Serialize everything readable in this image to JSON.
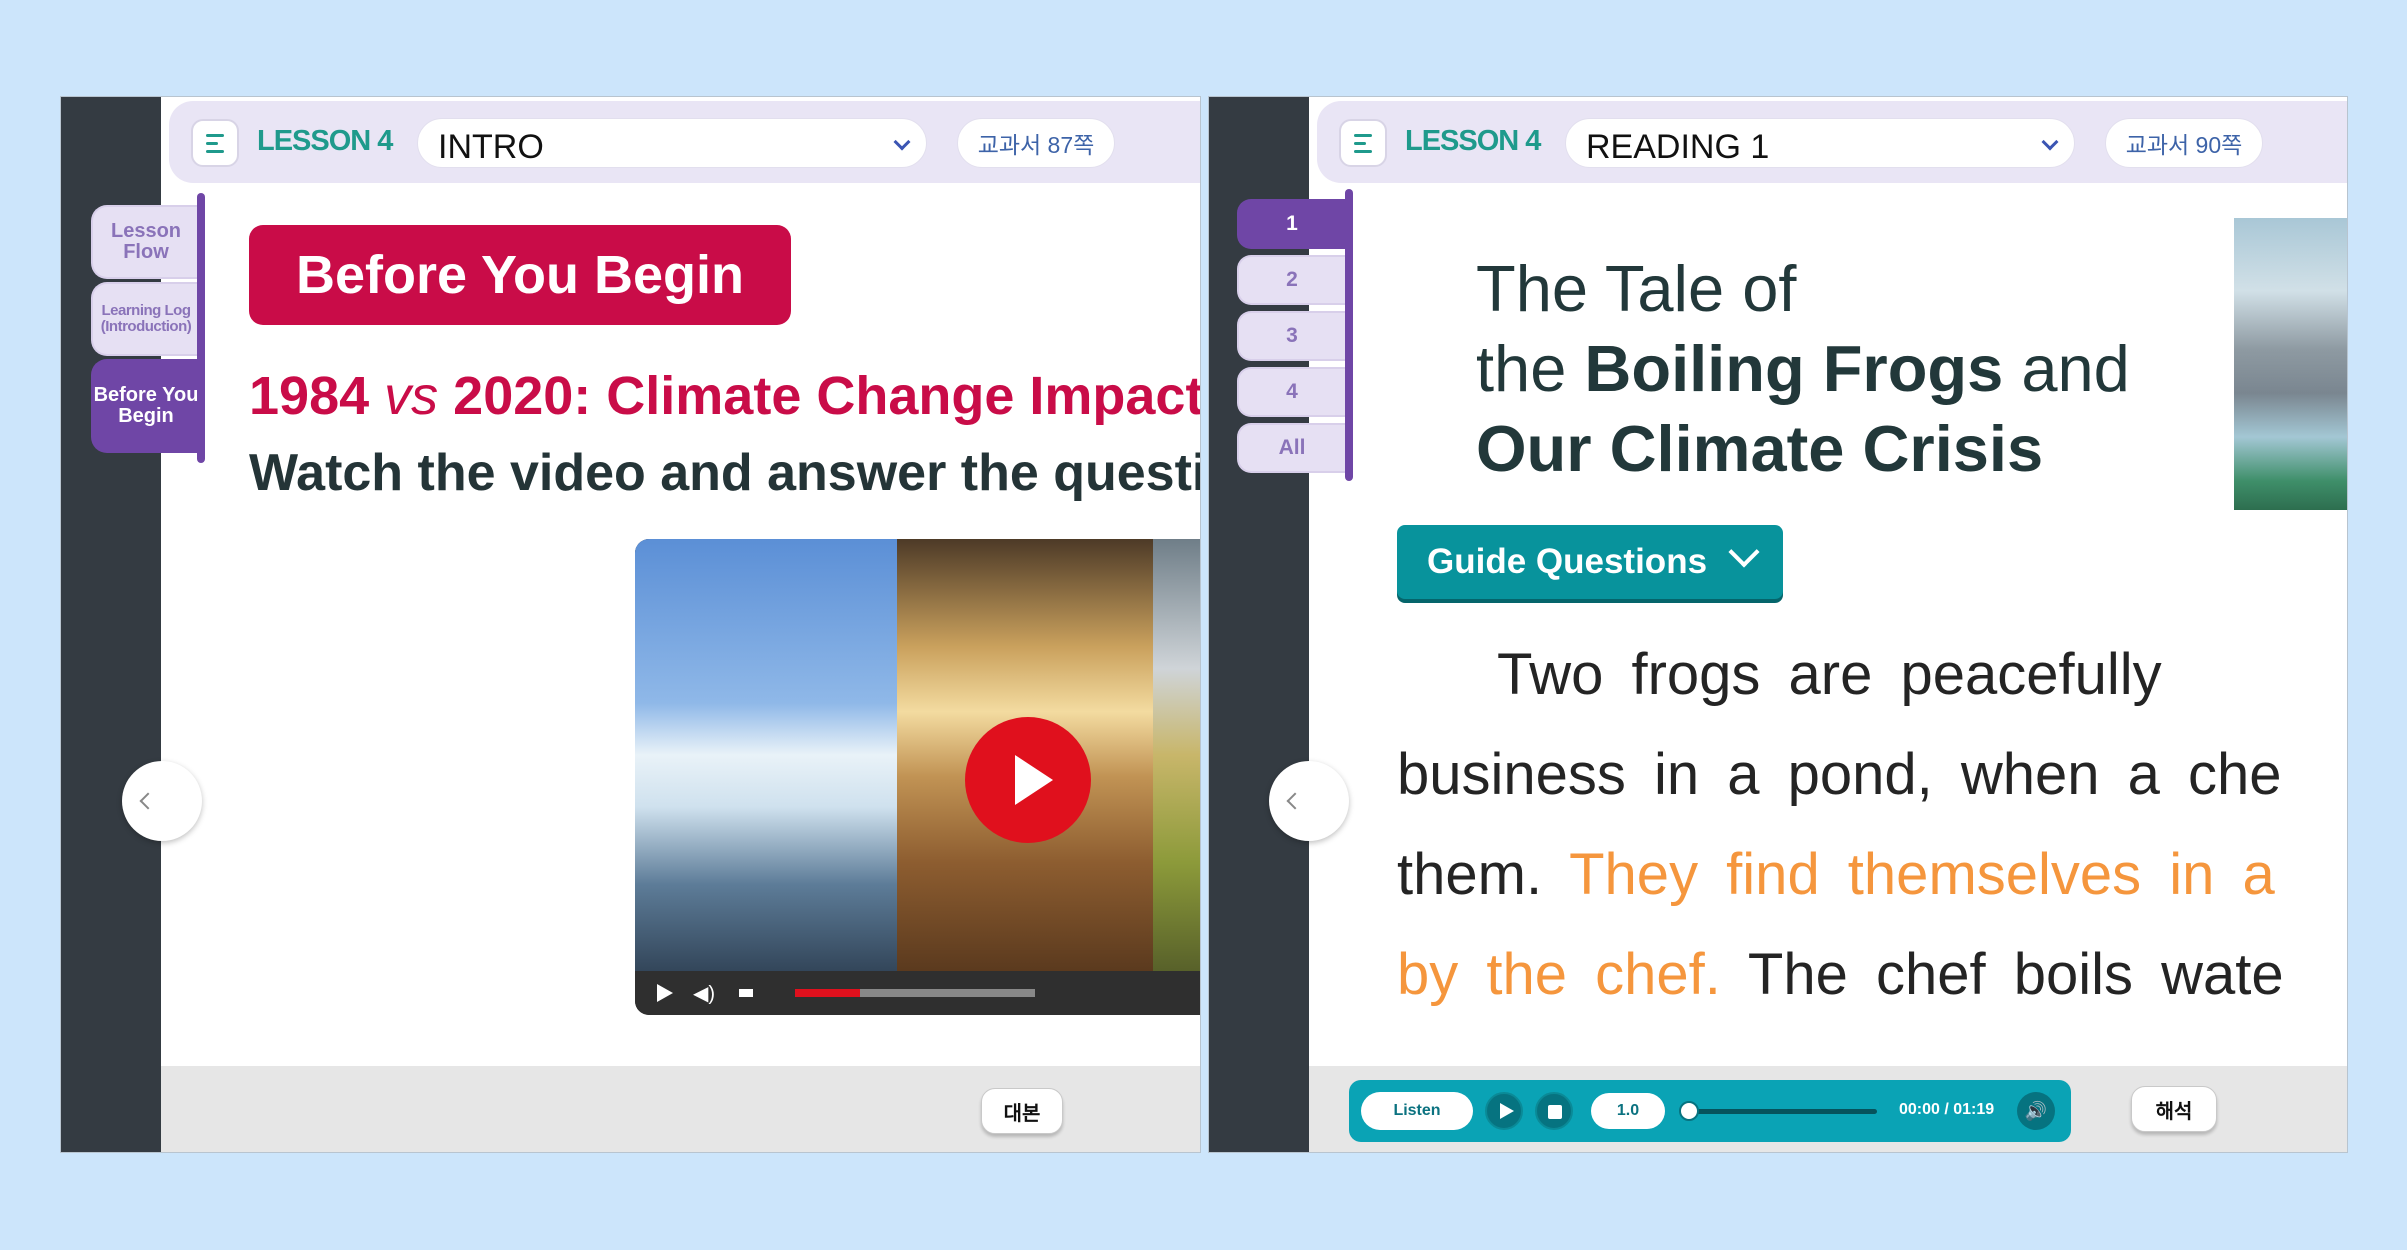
{
  "colors": {
    "background": "#cce5fb",
    "brand_teal": "#1f9a8c",
    "accent_red": "#c90c48",
    "purple": "#6f46a6",
    "highlight_orange": "#f5963d",
    "audio_teal": "#0aa3b5"
  },
  "left": {
    "header": {
      "lesson": "LESSON 4",
      "section": "INTRO",
      "page": "교과서 87쪽"
    },
    "side_tabs": [
      "Lesson Flow",
      "Learning Log (Introduction)",
      "Before You Begin"
    ],
    "active_tab": "Before You Begin",
    "banner": "Before You Begin",
    "title_year1": "1984",
    "title_vs": "vs",
    "title_rest": "2020: Climate Change Impact",
    "instruction": "Watch the video and answer the questions.",
    "video": {
      "scenes": [
        "melting-ice",
        "dry-desert",
        "green-hills"
      ],
      "progress": 0.27
    },
    "script_button": "대본"
  },
  "right": {
    "header": {
      "lesson": "LESSON 4",
      "section": "READING 1",
      "page": "교과서 90쪽"
    },
    "number_tabs": [
      "1",
      "2",
      "3",
      "4",
      "All"
    ],
    "active_number": "1",
    "title_line1": "The Tale of",
    "title_line2_pre": "the ",
    "title_line2_bold": "Boiling Frogs",
    "title_line2_post": " and",
    "title_line3": "Our Climate Crisis",
    "guide_button": "Guide Questions",
    "story": {
      "line1": "Two  frogs  are  peacefully",
      "line2": "business  in  a  pond,  when  a  che",
      "line3_plain": "them. ",
      "line3_highlight": "They find themselves in a",
      "line4_highlight": "by the chef.",
      "line4_plain": " The chef boils wate"
    },
    "audio": {
      "listen": "Listen",
      "speed": "1.0",
      "time": "00:00 /  01:19"
    },
    "translate_button": "해석"
  }
}
